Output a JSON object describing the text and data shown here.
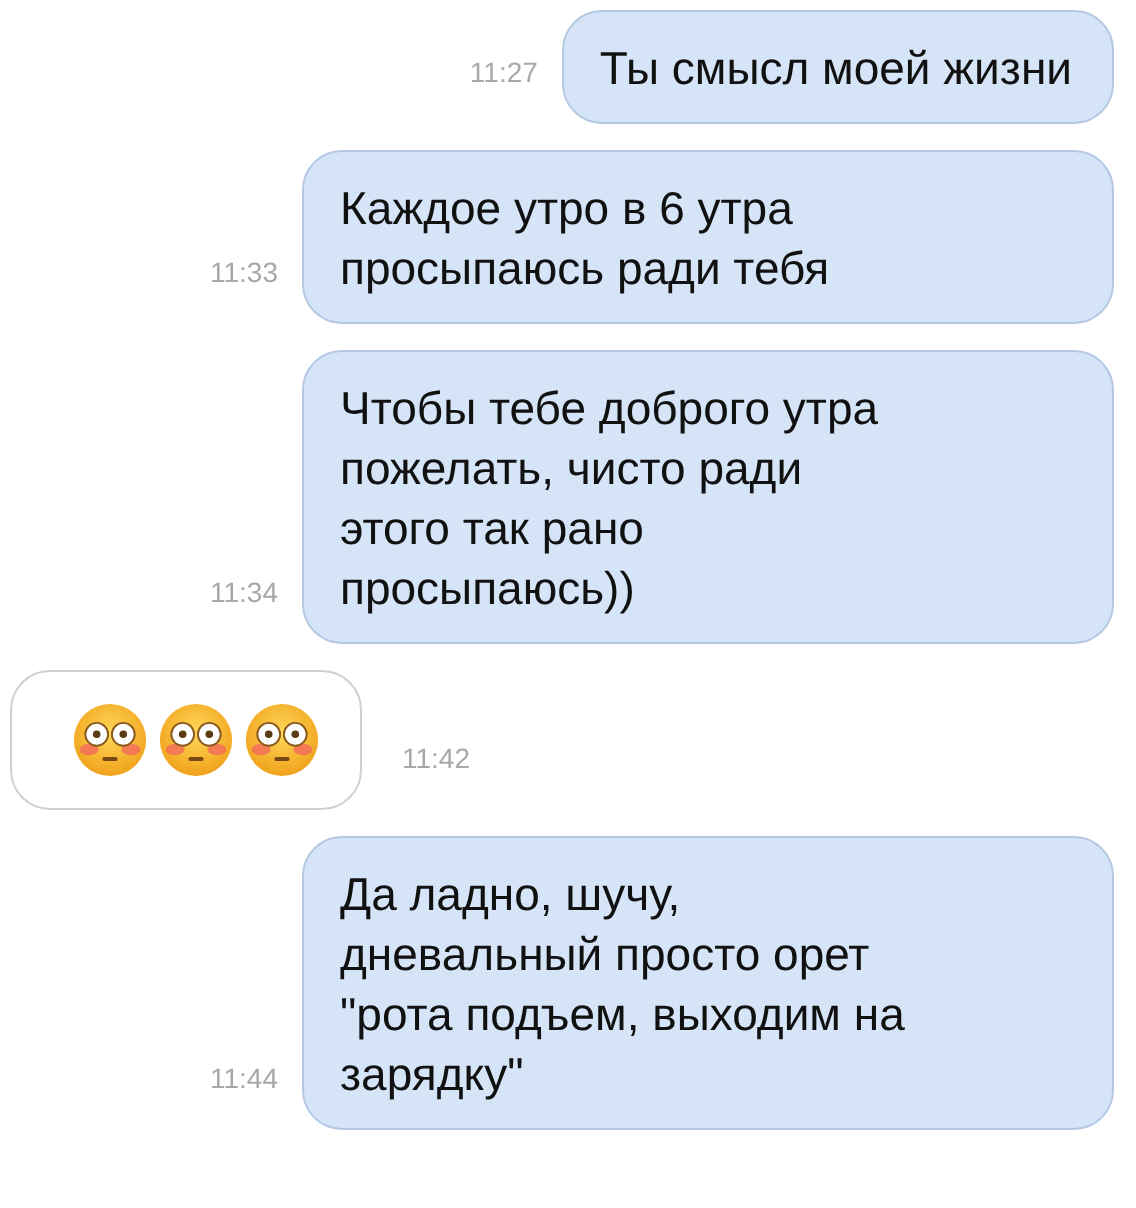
{
  "messages": [
    {
      "kind": "text",
      "outgoing": true,
      "time": "11:27",
      "text": "Ты смысл моей жизни"
    },
    {
      "kind": "text",
      "outgoing": true,
      "time": "11:33",
      "text": "Каждое утро в 6 утра\nпросыпаюсь ради тебя"
    },
    {
      "kind": "text",
      "outgoing": true,
      "time": "11:34",
      "text": "Чтобы тебе доброго утра\nпожелать, чисто ради\nэтого так рано\nпросыпаюсь))"
    },
    {
      "kind": "emoji",
      "outgoing": false,
      "time": "11:42",
      "emojis": [
        {
          "kind": "flushed"
        },
        {
          "kind": "flushed"
        },
        {
          "kind": "flushed"
        }
      ]
    },
    {
      "kind": "text",
      "outgoing": true,
      "time": "11:44",
      "text": "Да ладно, шучу,\nдневальный просто орет\n\"рота подъем, выходим на\nзарядку\""
    }
  ]
}
